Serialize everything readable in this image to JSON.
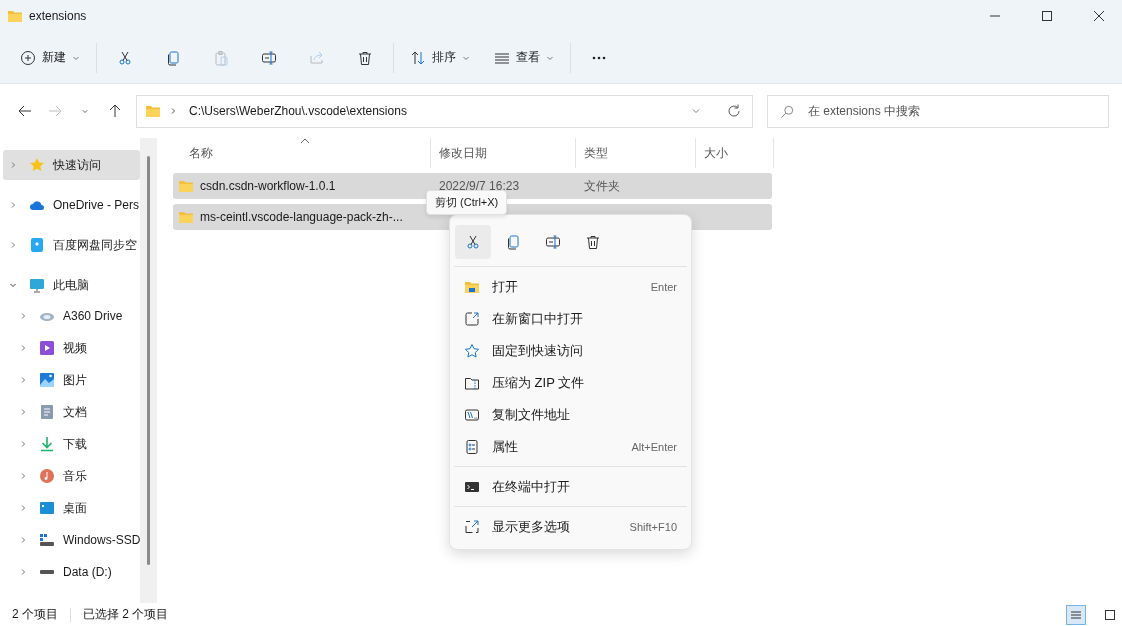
{
  "window": {
    "title": "extensions"
  },
  "toolbar": [
    {
      "kind": "new",
      "label": "新建",
      "dropdown": true,
      "disabled": false
    },
    {
      "kind": "cut",
      "disabled": false
    },
    {
      "kind": "copy",
      "disabled": false
    },
    {
      "kind": "paste",
      "disabled": true
    },
    {
      "kind": "rename",
      "disabled": false
    },
    {
      "kind": "share",
      "disabled": true
    },
    {
      "kind": "delete",
      "disabled": false
    },
    {
      "kind": "sort",
      "label": "排序",
      "dropdown": true,
      "disabled": false
    },
    {
      "kind": "view",
      "label": "查看",
      "dropdown": true,
      "disabled": false
    },
    {
      "kind": "more",
      "disabled": false
    }
  ],
  "nav": [
    {
      "kind": "back",
      "disabled": false
    },
    {
      "kind": "forward",
      "disabled": true
    },
    {
      "kind": "recent",
      "disabled": false
    },
    {
      "kind": "up",
      "disabled": false
    }
  ],
  "address": {
    "path": "C:\\Users\\WeberZhou\\.vscode\\extensions"
  },
  "search": {
    "placeholder": "在 extensions 中搜索"
  },
  "sidebar": {
    "items": [
      {
        "label": "快速访问",
        "kind": "star",
        "selected": true,
        "expanded": false
      },
      {
        "label": "OneDrive - Pers",
        "kind": "cloud",
        "selected": false,
        "expanded": false
      },
      {
        "label": "百度网盘同步空",
        "kind": "baidu",
        "selected": false,
        "expanded": false
      },
      {
        "label": "此电脑",
        "kind": "pc",
        "selected": false,
        "expanded": true,
        "children": [
          {
            "label": "A360 Drive",
            "kind": "a360",
            "selected": false,
            "expanded": false
          },
          {
            "label": "视频",
            "kind": "video",
            "selected": false,
            "expanded": false
          },
          {
            "label": "图片",
            "kind": "picture",
            "selected": false,
            "expanded": false
          },
          {
            "label": "文档",
            "kind": "doc",
            "selected": false,
            "expanded": false
          },
          {
            "label": "下载",
            "kind": "download",
            "selected": false,
            "expanded": false
          },
          {
            "label": "音乐",
            "kind": "music",
            "selected": false,
            "expanded": false
          },
          {
            "label": "桌面",
            "kind": "desktop",
            "selected": false,
            "expanded": false
          },
          {
            "label": "Windows-SSD",
            "kind": "windrive",
            "selected": false,
            "expanded": false
          },
          {
            "label": "Data (D:)",
            "kind": "drive",
            "selected": false,
            "expanded": false
          }
        ]
      }
    ]
  },
  "table": {
    "columns": [
      {
        "label": "名称",
        "sorted": true
      },
      {
        "label": "修改日期",
        "sorted": false
      },
      {
        "label": "类型",
        "sorted": false
      },
      {
        "label": "大小",
        "sorted": false
      }
    ],
    "rows": [
      {
        "name": "csdn.csdn-workflow-1.0.1",
        "date": "2022/9/7 16:23",
        "type": "文件夹",
        "selected": true
      },
      {
        "name": "ms-ceintl.vscode-language-pack-zh-...",
        "selected": true
      }
    ]
  },
  "tooltip": "剪切 (Ctrl+X)",
  "context_menu": {
    "quick_actions": [
      {
        "kind": "cut",
        "hover": true
      },
      {
        "kind": "copy",
        "hover": false
      },
      {
        "kind": "rename",
        "hover": false
      },
      {
        "kind": "delete",
        "hover": false
      }
    ],
    "groups": [
      [
        {
          "kind": "open",
          "label": "打开",
          "shortcut": "Enter"
        },
        {
          "kind": "newwindow",
          "label": "在新窗口中打开"
        },
        {
          "kind": "pin",
          "label": "固定到快速访问"
        },
        {
          "kind": "zip",
          "label": "压缩为 ZIP 文件"
        },
        {
          "kind": "copypath",
          "label": "复制文件地址"
        },
        {
          "kind": "props",
          "label": "属性",
          "shortcut": "Alt+Enter"
        }
      ],
      [
        {
          "kind": "terminal",
          "label": "在终端中打开"
        }
      ],
      [
        {
          "kind": "moreopts",
          "label": "显示更多选项",
          "shortcut": "Shift+F10"
        }
      ]
    ]
  },
  "status_bar": {
    "count": "2 个项目",
    "selection": "已选择 2 个项目"
  },
  "view_toggle": [
    {
      "kind": "details",
      "selected": true
    },
    {
      "kind": "tiles",
      "selected": false
    }
  ]
}
